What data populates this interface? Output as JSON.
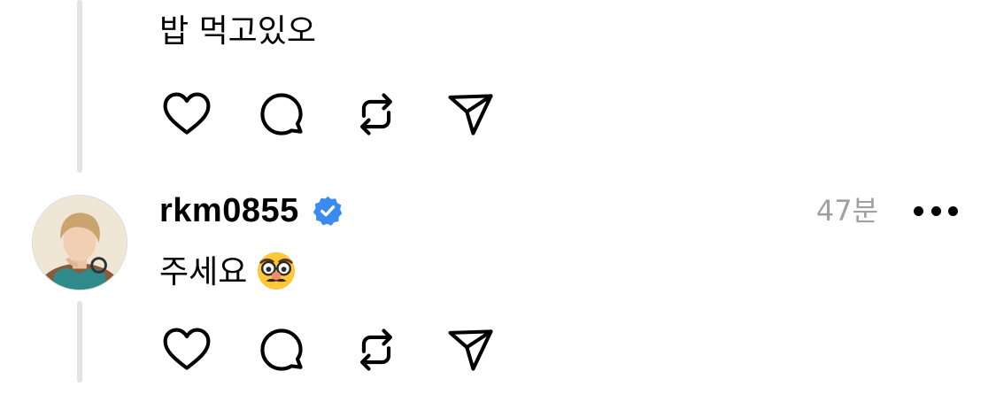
{
  "reply_above": {
    "text": "밥 먹고있오"
  },
  "reply": {
    "username": "rkm0855",
    "verified": true,
    "timestamp": "47분",
    "text": "주세요",
    "emoji": "disguised-face-emoji"
  },
  "actions": [
    "heart-icon",
    "comment-icon",
    "repost-icon",
    "share-icon"
  ],
  "colors": {
    "verified_badge": "#3b8af2",
    "timestamp": "#a0a0a0",
    "thread_line": "#e3e3e3"
  }
}
